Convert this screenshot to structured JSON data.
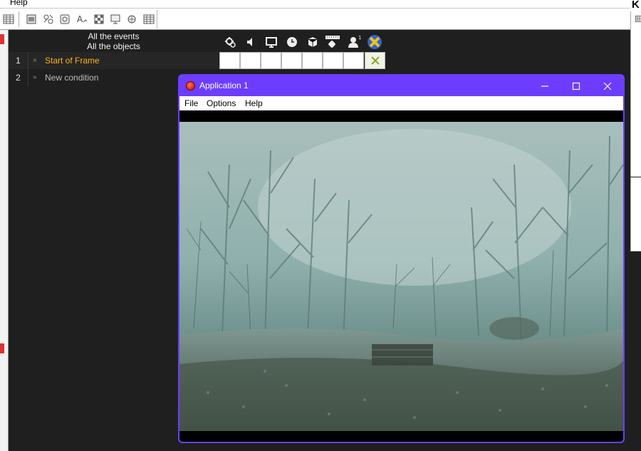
{
  "menubar": {
    "help_label": "Help"
  },
  "toolbar": {
    "buttons": [
      "grid-icon",
      "frame-editor-icon",
      "event-list-icon",
      "event-editor-icon",
      "text-icon",
      "checker-icon",
      "storyboard-icon",
      "debug-icon",
      "table-icon"
    ]
  },
  "right_panel": {
    "title_fragment": "K",
    "collapse_glyph": "⊟"
  },
  "event_editor": {
    "header_line1": "All the events",
    "header_line2": "All the objects",
    "rows": [
      {
        "number": "1",
        "text": "Start of Frame",
        "color": "#ffb020"
      },
      {
        "number": "2",
        "text": "New condition",
        "color": "#bdbdbd"
      }
    ],
    "object_icons": [
      "special-conditions-icon",
      "sound-icon",
      "storyboard-controls-icon",
      "timer-icon",
      "create-objects-icon",
      "keyboard-mouse-icon",
      "player-icon",
      "active-object-icon"
    ],
    "player_superscript": "1"
  },
  "app_window": {
    "title": "Application 1",
    "accent": "#6c3dff",
    "menu": [
      "File",
      "Options",
      "Help"
    ],
    "controls": [
      "minimize-icon",
      "maximize-icon",
      "close-icon"
    ]
  }
}
